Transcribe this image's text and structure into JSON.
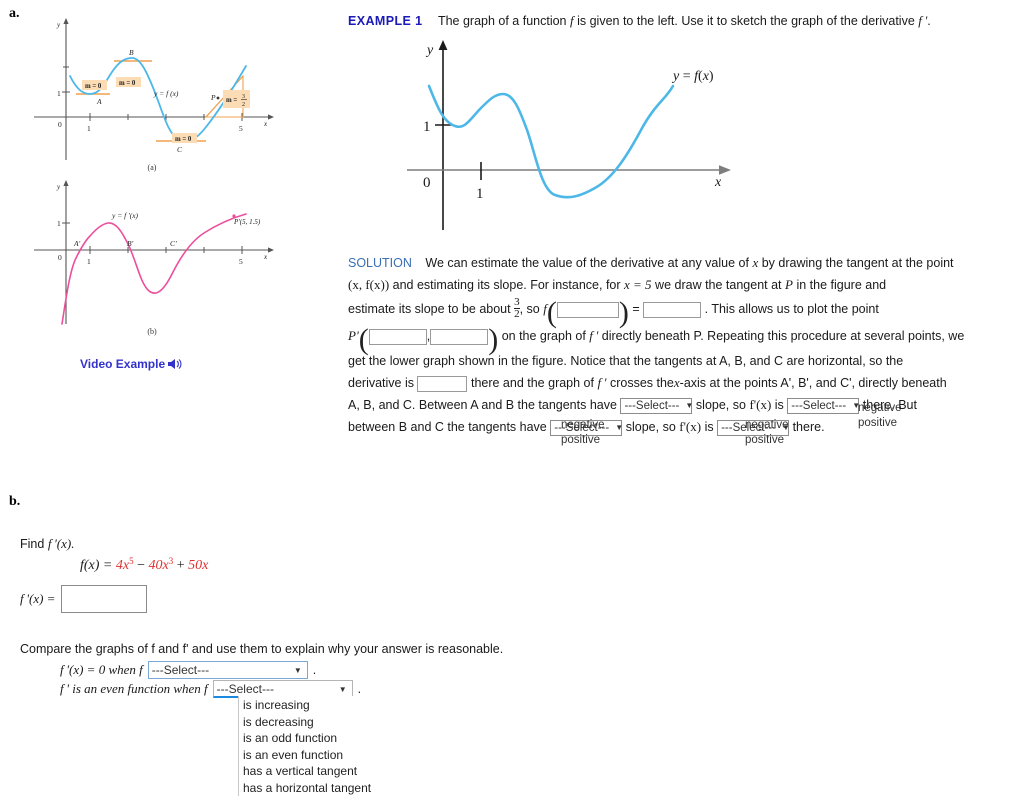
{
  "parts": {
    "a_label": "a.",
    "b_label": "b."
  },
  "figures": {
    "fig_a": {
      "caption": "(a)",
      "axis_y": "y",
      "axis_x": "x",
      "origin": "0",
      "tick_x": "1",
      "tick_x2": "5",
      "tick_y": "1",
      "curve_label": "y = f(x)",
      "point_A": "A",
      "point_B": "B",
      "point_C": "C",
      "point_P": "P",
      "slope_A": "m = 0",
      "slope_B": "m = 0",
      "slope_C": "m = 0",
      "slope_P_num": "3",
      "slope_P_den": "2",
      "slope_P_prefix": "m =",
      "curve_color": "#4db8e8",
      "accent_color": "#f0a04b"
    },
    "fig_b": {
      "caption": "(b)",
      "axis_y": "y",
      "axis_x": "x",
      "origin": "0",
      "tick_x": "1",
      "tick_x2": "5",
      "tick_y": "1",
      "curve_label": "y = f'(x)",
      "point_A": "A'",
      "point_B": "B'",
      "point_C": "C'",
      "point_P": "P'(5, 1.5)",
      "curve_color": "#ec4f9c"
    },
    "video_example": {
      "label": "Video Example",
      "icon": "speaker-icon"
    }
  },
  "example": {
    "heading": "EXAMPLE 1",
    "statement_1": "The graph of a function",
    "statement_f": "f",
    "statement_2": "is given to the left. Use it to sketch the graph of the derivative",
    "statement_fprime": "f '",
    "statement_period": "."
  },
  "main_graph": {
    "axis_y": "y",
    "axis_x": "x",
    "origin": "0",
    "tick_x": "1",
    "tick_y": "1",
    "curve_label": "y = f(x)",
    "curve_color": "#4db8e8"
  },
  "solution": {
    "heading": "SOLUTION",
    "line1": "We can estimate the value of the derivative at any value of",
    "line1_x": "x",
    "line1b": "by drawing the tangent at the point",
    "line2_xfx": "(x, f(x))",
    "line2": "and estimating its slope. For instance, for",
    "line2_xeq": "x = 5",
    "line2b": "we draw the tangent at",
    "line2_P": "P",
    "line2c": "in the figure and",
    "line3a": "estimate its slope to be about",
    "frac_num": "3",
    "frac_den": "2",
    "line3_so": ", so",
    "line3_f": "f",
    "line3_eq": "=",
    "line3_end": ". This allows us to plot the point",
    "line4_P": "P'",
    "line4_comma": ",",
    "line4": "on the graph of",
    "line4_fprime": "f '",
    "line4b": "directly beneath P. Repeating this procedure at several points, we",
    "line5": "get the lower graph shown in the figure. Notice that the tangents at A, B, and C are horizontal, so the",
    "line6a": "derivative is",
    "line6b": "there and the graph of",
    "line6_fprime": "f '",
    "line6c": "crosses the",
    "line6_xaxis": "x",
    "line6d": "-axis at the points A', B', and C', directly beneath",
    "line7a": "A, B, and C. Between A and B the tangents have",
    "line7b": "slope, so",
    "line7_fpx": "f'(x)",
    "line7c": "is",
    "line7d": "there. But",
    "line8a": "between B and C the tangents have",
    "line8b": "slope, so",
    "line8_fpx": "f'(x)",
    "line8c": "is",
    "line8d": "there.",
    "select_placeholder": "---Select---",
    "select_caret": "▼",
    "options": [
      "negative",
      "positive"
    ]
  },
  "partb": {
    "find_label_1": "Find",
    "find_label_2": "f '(x).",
    "equation": "f(x) = ",
    "term1": "4x",
    "term1_exp": "5",
    "minus": " − ",
    "term2": "40x",
    "term2_exp": "3",
    "plus": " + ",
    "term3": "50x",
    "answer_label": "f '(x) =",
    "answer_value": "",
    "compare_text": "Compare the graphs of f and f' and use them to explain why your answer is reasonable.",
    "q1_prefix": "f '(x) = 0 when f",
    "q1_suffix": ".",
    "q2_prefix": "f ' is an even function when f",
    "q2_suffix": ".",
    "select_placeholder": "---Select---",
    "select_caret": "▼",
    "dropdown_options": [
      "is increasing",
      "is decreasing",
      "is an odd function",
      "is an even function",
      "has a vertical tangent",
      "has a horizontal tangent"
    ]
  }
}
